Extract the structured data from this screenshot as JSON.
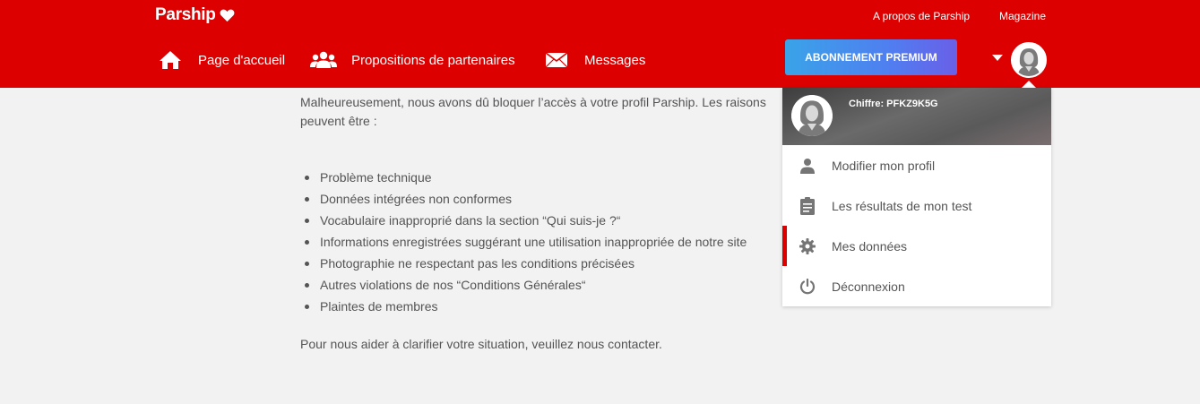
{
  "header": {
    "logo_text": "Parship",
    "top_links": {
      "about": "A propos de Parship",
      "magazine": "Magazine"
    },
    "nav": [
      {
        "label": "Page d'accueil",
        "icon": "home-icon"
      },
      {
        "label": "Propositions de partenaires",
        "icon": "users-icon"
      },
      {
        "label": "Messages",
        "icon": "envelope-icon"
      }
    ],
    "premium_label": "ABONNEMENT PREMIUM"
  },
  "content": {
    "intro": "Malheureusement, nous avons dû bloquer l’accès à votre profil Parship. Les raisons peuvent être :",
    "reasons": [
      "Problème technique",
      "Données intégrées non conformes",
      "Vocabulaire inapproprié dans la section “Qui suis-je ?“",
      "Informations enregistrées suggérant une utilisation inappropriée de notre site",
      "Photographie ne respectant pas les conditions précisées",
      "Autres violations de nos “Conditions Générales“",
      "Plaintes de membres"
    ],
    "outro": "Pour nous aider à clarifier votre situation, veuillez nous contacter."
  },
  "dropdown": {
    "code_label": "Chiffre: PFKZ9K5G",
    "items": [
      {
        "label": "Modifier mon profil",
        "icon": "user-icon"
      },
      {
        "label": "Les résultats de mon test",
        "icon": "clipboard-icon"
      },
      {
        "label": "Mes données",
        "icon": "gear-icon"
      },
      {
        "label": "Déconnexion",
        "icon": "power-icon"
      }
    ]
  },
  "colors": {
    "brand_red": "#dc0000",
    "premium_blue": "#4f7ff0",
    "text": "#545454",
    "background": "#f2f2f2"
  }
}
